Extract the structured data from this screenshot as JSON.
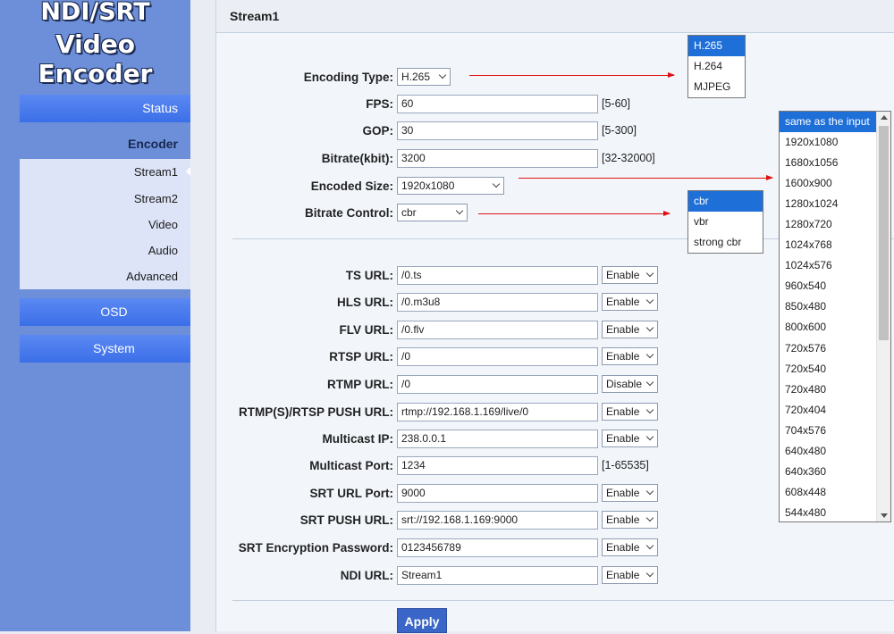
{
  "logo": {
    "line1": "NDI/SRT",
    "line2": "Video Encoder"
  },
  "sidebar": {
    "status": "Status",
    "encoder": "Encoder",
    "sub_items": [
      "Stream1",
      "Stream2",
      "Video",
      "Audio",
      "Advanced"
    ],
    "osd": "OSD",
    "system": "System"
  },
  "main": {
    "title": "Stream1",
    "encoding": {
      "encoding_type": {
        "label": "Encoding Type:",
        "value": "H.265"
      },
      "fps": {
        "label": "FPS:",
        "value": "60",
        "range": "[5-60]"
      },
      "gop": {
        "label": "GOP:",
        "value": "30",
        "range": "[5-300]"
      },
      "bitrate": {
        "label": "Bitrate(kbit):",
        "value": "3200",
        "range": "[32-32000]"
      },
      "encoded_size": {
        "label": "Encoded Size:",
        "value": "1920x1080"
      },
      "bitrate_control": {
        "label": "Bitrate Control:",
        "value": "cbr"
      }
    },
    "urls": {
      "ts": {
        "label": "TS URL:",
        "value": "/0.ts",
        "state": "Enable"
      },
      "hls": {
        "label": "HLS URL:",
        "value": "/0.m3u8",
        "state": "Enable"
      },
      "flv": {
        "label": "FLV URL:",
        "value": "/0.flv",
        "state": "Enable"
      },
      "rtsp": {
        "label": "RTSP URL:",
        "value": "/0",
        "state": "Enable"
      },
      "rtmp": {
        "label": "RTMP URL:",
        "value": "/0",
        "state": "Disable"
      },
      "rtmp_push": {
        "label": "RTMP(S)/RTSP PUSH URL:",
        "value": "rtmp://192.168.1.169/live/0",
        "state": "Enable"
      },
      "multicast_ip": {
        "label": "Multicast IP:",
        "value": "238.0.0.1",
        "state": "Enable"
      },
      "multicast_port": {
        "label": "Multicast Port:",
        "value": "1234",
        "range": "[1-65535]"
      },
      "srt_port": {
        "label": "SRT URL Port:",
        "value": "9000",
        "state": "Enable"
      },
      "srt_push": {
        "label": "SRT PUSH URL:",
        "value": "srt://192.168.1.169:9000",
        "state": "Enable"
      },
      "srt_password": {
        "label": "SRT Encryption Password:",
        "value": "0123456789",
        "state": "Enable"
      },
      "ndi": {
        "label": "NDI URL:",
        "value": "Stream1",
        "state": "Enable"
      }
    },
    "apply_label": "Apply"
  },
  "dropdowns": {
    "encoding_type": [
      "H.265",
      "H.264",
      "MJPEG"
    ],
    "bitrate_control": [
      "cbr",
      "vbr",
      "strong cbr"
    ],
    "encoded_size": [
      "same as the input",
      "1920x1080",
      "1680x1056",
      "1600x900",
      "1280x1024",
      "1280x720",
      "1024x768",
      "1024x576",
      "960x540",
      "850x480",
      "800x600",
      "720x576",
      "720x540",
      "720x480",
      "720x404",
      "704x576",
      "640x480",
      "640x360",
      "608x448",
      "544x480"
    ]
  },
  "colors": {
    "sidebar_bg": "#6d8fd9",
    "nav_button": "#3b6fe8",
    "selected_option": "#1e6fd8",
    "apply_button": "#3a67c7",
    "annotation_arrow": "#e01010"
  }
}
